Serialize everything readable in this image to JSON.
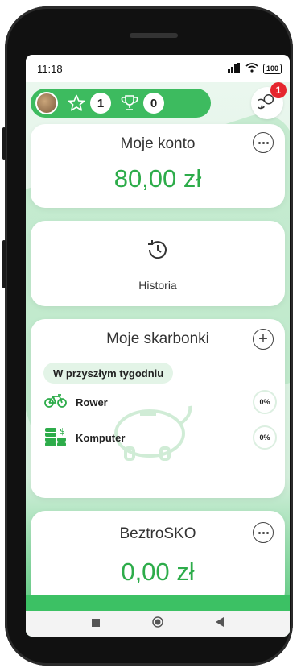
{
  "status": {
    "time": "11:18",
    "battery": "100"
  },
  "header": {
    "stars": "1",
    "trophies": "0",
    "notifications": "1"
  },
  "account": {
    "title": "Moje konto",
    "balance": "80,00 zł"
  },
  "history": {
    "label": "Historia"
  },
  "savings": {
    "title": "Moje skarbonki",
    "period_chip": "W przyszłym tygodniu",
    "goals": [
      {
        "label": "Rower",
        "percent": "0%",
        "icon": "bicycle-icon"
      },
      {
        "label": "Komputer",
        "percent": "0%",
        "icon": "coins-icon"
      }
    ]
  },
  "beztrosko": {
    "title": "BeztroSKO",
    "balance": "0,00 zł"
  },
  "colors": {
    "brand_green": "#3dbb5f",
    "amount_green": "#2dac4a",
    "badge_red": "#e5262e"
  }
}
